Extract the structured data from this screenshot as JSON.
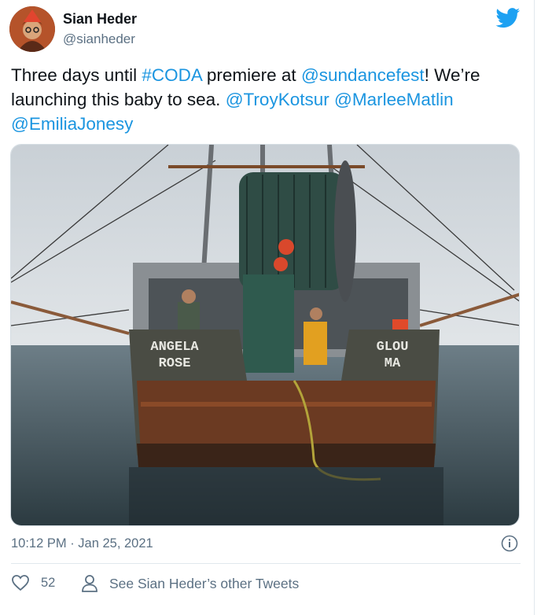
{
  "tweet": {
    "author_name": "Sian Heder",
    "author_handle": "@sianheder",
    "text_parts": {
      "p1": "Three days until ",
      "hashtag": "#CODA",
      "p2": " premiere at ",
      "mention_festival": "@sundancefest",
      "p3": "! We’re launching this baby to sea. ",
      "mention_1": "@TroyKotsur",
      "p4": " ",
      "mention_2": "@MarleeMatlin",
      "p5": " ",
      "mention_3": "@EmiliaJonesy"
    },
    "photo": {
      "hull_left_text_line1": "ANGELA",
      "hull_left_text_line2": "ROSE",
      "hull_right_text_line1": "GLOU",
      "hull_right_text_line2": "MA"
    },
    "timestamp": "10:12 PM · Jan 25, 2021",
    "like_count": "52",
    "other_tweets_label": "See Sian Heder’s other Tweets"
  },
  "colors": {
    "link": "#1b95e0",
    "twitter_blue": "#1da1f2",
    "secondary_text": "#5b7083"
  },
  "icons": [
    "twitter-bird-icon",
    "info-icon",
    "heart-icon",
    "person-icon"
  ]
}
